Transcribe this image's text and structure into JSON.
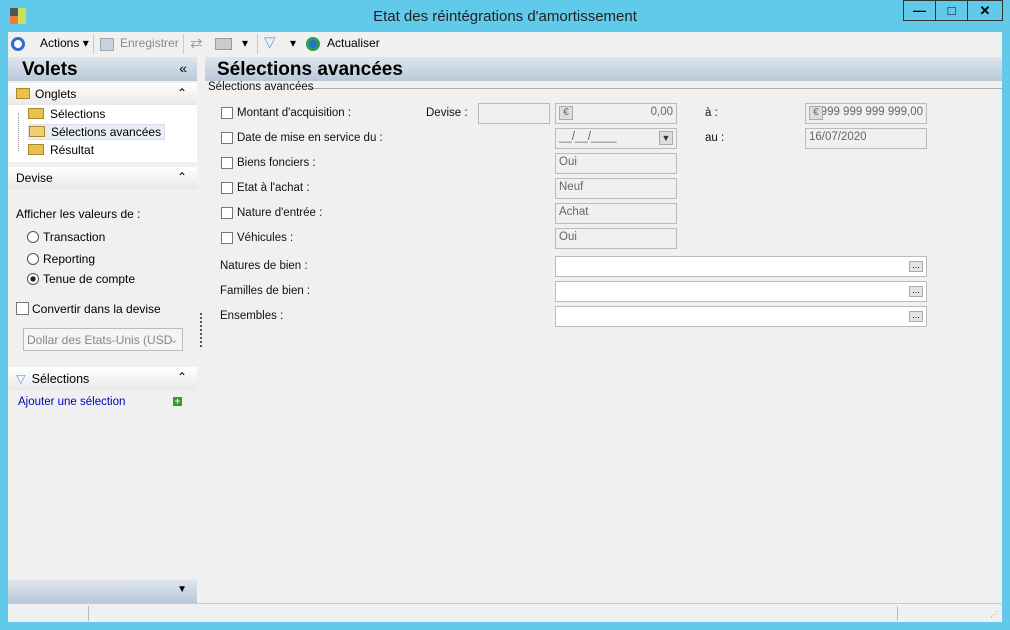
{
  "window": {
    "title": "Etat des réintégrations d'amortissement"
  },
  "toolbar": {
    "actions": "Actions",
    "save": "Enregistrer",
    "refresh": "Actualiser"
  },
  "left": {
    "title": "Volets",
    "onglets": {
      "title": "Onglets",
      "items": [
        "Sélections",
        "Sélections avancées",
        "Résultat"
      ]
    },
    "devise": {
      "title": "Devise",
      "show_label": "Afficher les valeurs de :",
      "options": [
        "Transaction",
        "Reporting",
        "Tenue de compte"
      ],
      "selected": "Tenue de compte",
      "convert_label": "Convertir dans la devise",
      "currency": "Dollar des Etats-Unis (USD"
    },
    "selections": {
      "title": "Sélections",
      "add_link": "Ajouter une sélection"
    }
  },
  "main": {
    "title": "Sélections avancées",
    "group": "Sélections avancées",
    "montant": {
      "label": "Montant d'acquisition :",
      "devise_label": "Devise :",
      "devise": "",
      "from": "0,00",
      "to_label": "à :",
      "to": "999 999 999 999,00"
    },
    "date": {
      "label": "Date de mise en service du :",
      "from": "__/__/____",
      "to_label": "au :",
      "to": "16/07/2020"
    },
    "biens_fonciers": {
      "label": "Biens fonciers :",
      "value": "Oui"
    },
    "etat": {
      "label": "Etat à l'achat :",
      "value": "Neuf"
    },
    "nature": {
      "label": "Nature d'entrée :",
      "value": "Achat"
    },
    "vehicules": {
      "label": "Véhicules :",
      "value": "Oui"
    },
    "natures_bien": {
      "label": "Natures de bien :",
      "value": ""
    },
    "familles_bien": {
      "label": "Familles de bien :",
      "value": ""
    },
    "ensembles": {
      "label": "Ensembles :",
      "value": ""
    }
  },
  "colors": {
    "accent": "#61c9ea",
    "link": "#0000c0"
  }
}
